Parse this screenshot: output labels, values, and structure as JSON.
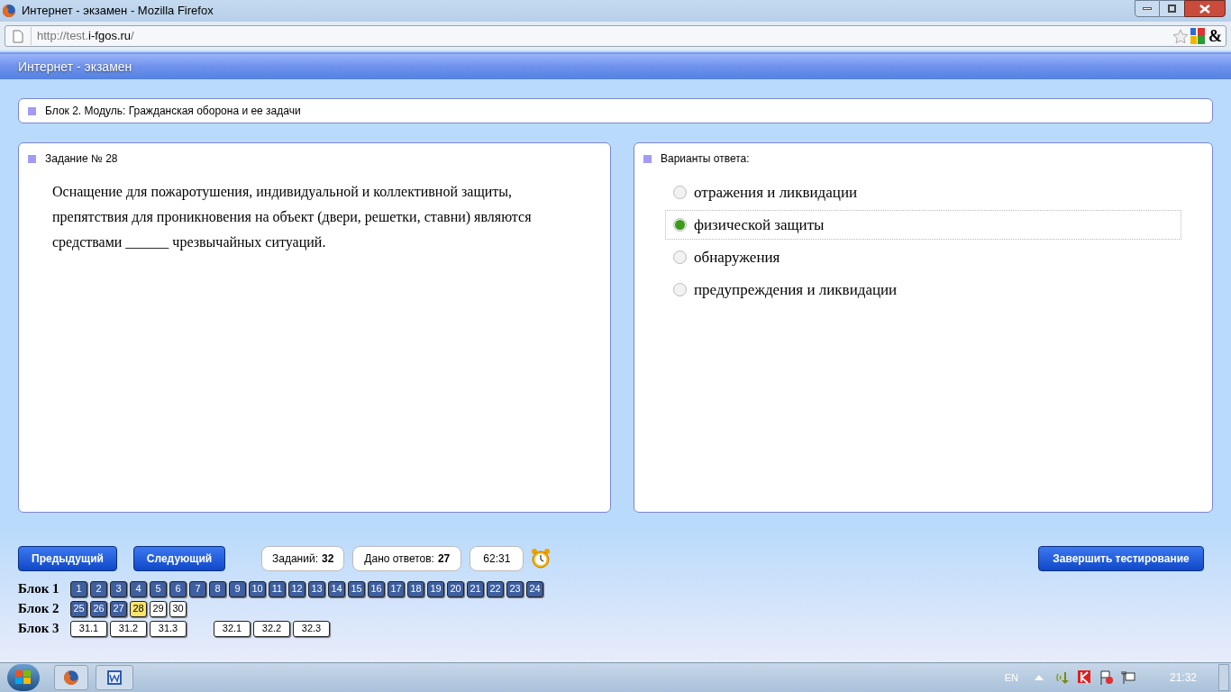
{
  "window": {
    "title": "Интернет - экзамен - Mozilla Firefox"
  },
  "address_bar": {
    "url_prefix": "http://test.",
    "url_host": "i-fgos.ru",
    "url_suffix": "/",
    "addon_glyph": "&"
  },
  "app_header": {
    "title": "Интернет - экзамен"
  },
  "module": {
    "label": "Блок 2. Модуль: Гражданская оборона и ее задачи"
  },
  "task": {
    "label": "Задание № 28",
    "text": "Оснащение для пожаротушения, индивидуальной и коллективной защиты, препятствия для проникновения на объект (двери, решетки, ставни) являются средствами ______ чрезвычайных ситуаций."
  },
  "answers": {
    "label": "Варианты ответа:",
    "options": [
      {
        "text": "отражения и ликвидации",
        "selected": false
      },
      {
        "text": "физической защиты",
        "selected": true
      },
      {
        "text": "обнаружения",
        "selected": false
      },
      {
        "text": "предупреждения и ликвидации",
        "selected": false
      }
    ]
  },
  "controls": {
    "prev": "Предыдущий",
    "next": "Следующий",
    "tasks_label": "Заданий:",
    "tasks_count": "32",
    "answered_label": "Дано ответов:",
    "answered_count": "27",
    "timer": "62:31",
    "finish": "Завершить тестирование"
  },
  "blocks": [
    {
      "label": "Блок 1",
      "groups": [
        [
          {
            "n": "1",
            "answered": true,
            "selected": false
          },
          {
            "n": "2",
            "answered": true,
            "selected": false
          },
          {
            "n": "3",
            "answered": true,
            "selected": false
          },
          {
            "n": "4",
            "answered": true,
            "selected": false
          },
          {
            "n": "5",
            "answered": true,
            "selected": false
          },
          {
            "n": "6",
            "answered": true,
            "selected": false
          },
          {
            "n": "7",
            "answered": true,
            "selected": false
          },
          {
            "n": "8",
            "answered": true,
            "selected": false
          },
          {
            "n": "9",
            "answered": true,
            "selected": false
          },
          {
            "n": "10",
            "answered": true,
            "selected": false
          },
          {
            "n": "11",
            "answered": true,
            "selected": false
          },
          {
            "n": "12",
            "answered": true,
            "selected": false
          },
          {
            "n": "13",
            "answered": true,
            "selected": false
          },
          {
            "n": "14",
            "answered": true,
            "selected": false
          },
          {
            "n": "15",
            "answered": true,
            "selected": false
          },
          {
            "n": "16",
            "answered": true,
            "selected": false
          },
          {
            "n": "17",
            "answered": true,
            "selected": false
          },
          {
            "n": "18",
            "answered": true,
            "selected": false
          },
          {
            "n": "19",
            "answered": true,
            "selected": false
          },
          {
            "n": "20",
            "answered": true,
            "selected": false
          },
          {
            "n": "21",
            "answered": true,
            "selected": false
          },
          {
            "n": "22",
            "answered": true,
            "selected": false
          },
          {
            "n": "23",
            "answered": true,
            "selected": false
          },
          {
            "n": "24",
            "answered": true,
            "selected": false
          }
        ]
      ]
    },
    {
      "label": "Блок 2",
      "groups": [
        [
          {
            "n": "25",
            "answered": true,
            "selected": false
          },
          {
            "n": "26",
            "answered": true,
            "selected": false
          },
          {
            "n": "27",
            "answered": true,
            "selected": false
          },
          {
            "n": "28",
            "answered": false,
            "selected": true
          },
          {
            "n": "29",
            "answered": false,
            "selected": false
          },
          {
            "n": "30",
            "answered": false,
            "selected": false
          }
        ]
      ]
    },
    {
      "label": "Блок 3",
      "groups": [
        [
          {
            "n": "31.1",
            "answered": false,
            "selected": false
          },
          {
            "n": "31.2",
            "answered": false,
            "selected": false
          },
          {
            "n": "31.3",
            "answered": false,
            "selected": false
          }
        ],
        [
          {
            "n": "32.1",
            "answered": false,
            "selected": false
          },
          {
            "n": "32.2",
            "answered": false,
            "selected": false
          },
          {
            "n": "32.3",
            "answered": false,
            "selected": false
          }
        ]
      ]
    }
  ],
  "taskbar": {
    "language": "EN",
    "clock": "21:32"
  }
}
